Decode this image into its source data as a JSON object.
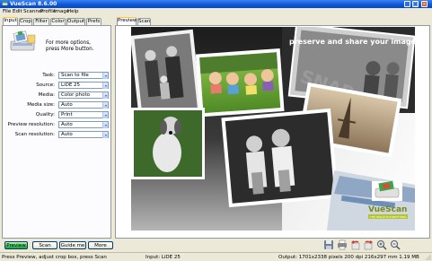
{
  "window": {
    "title": "VueScan 8.6.00"
  },
  "menu": [
    "File",
    "Edit",
    "Scanner",
    "Profile",
    "Image",
    "Help"
  ],
  "left_tabs": [
    "Input",
    "Crop",
    "Filter",
    "Color",
    "Output",
    "Prefs"
  ],
  "left_tab_active": "Input",
  "help_text": {
    "line1": "For more options,",
    "line2": "press More button."
  },
  "fields": [
    {
      "label": "Task:",
      "value": "Scan to file"
    },
    {
      "label": "Source:",
      "value": "LiDE 25"
    },
    {
      "label": "Media:",
      "value": "Color photo"
    },
    {
      "label": "Media size:",
      "value": "Auto"
    },
    {
      "label": "Quality:",
      "value": "Print"
    },
    {
      "label": "Preview resolution:",
      "value": "Auto"
    },
    {
      "label": "Scan resolution:",
      "value": "Auto"
    }
  ],
  "right_tabs": [
    "Preview",
    "Scan"
  ],
  "right_tab_active": "Preview",
  "promo": {
    "headline": "preserve and share your images",
    "logo_text": "VueScan",
    "tagline": "THE IMAGE IS EVERYTHING",
    "snap_text": "SNAP"
  },
  "buttons": {
    "preview": "Preview",
    "scan": "Scan",
    "guide": "Guide me",
    "more": "More"
  },
  "toolbar_icons": [
    "save-icon",
    "print-icon",
    "rotate-left-icon",
    "rotate-right-icon",
    "zoom-in-icon",
    "zoom-out-icon"
  ],
  "status": {
    "left": "Press Preview, adjust crop box, press Scan",
    "middle": "Input: LiDE 25",
    "right": "Output: 1701x2338 pixels 200 dpi 216x297 mm 1.19 MB"
  },
  "colors": {
    "accent": "#0a56d8",
    "preview_button": "#3bc24b",
    "tab_highlight": "#ffc83c"
  }
}
